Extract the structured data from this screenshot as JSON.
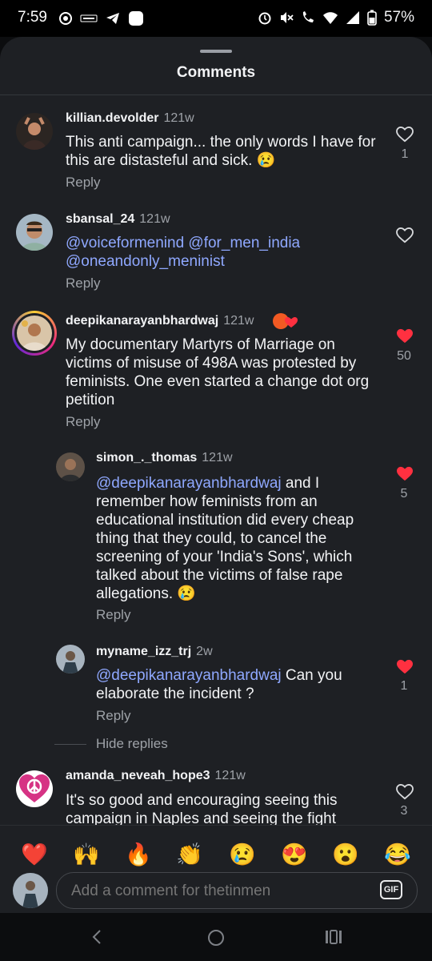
{
  "status_bar": {
    "time": "7:59",
    "battery": "57%"
  },
  "sheet": {
    "title": "Comments"
  },
  "comments": [
    {
      "username": "killian.devolder",
      "time": "121w",
      "text": "This anti campaign... the only words I have for this are distasteful and sick. 😢",
      "reply_label": "Reply",
      "likes": "1",
      "liked": false
    },
    {
      "username": "sbansal_24",
      "time": "121w",
      "mentions": [
        "@voiceformenind",
        "@for_men_india",
        "@oneandonly_meninist"
      ],
      "reply_label": "Reply",
      "likes": "",
      "liked": false
    },
    {
      "username": "deepikanarayanbhardwaj",
      "time": "121w",
      "text": "My documentary Martyrs of Marriage on victims of misuse of 498A was protested by feminists. One even started a change dot org petition",
      "reply_label": "Reply",
      "likes": "50",
      "liked": true
    },
    {
      "username": "simon_._thomas",
      "time": "121w",
      "mention": "@deepikanarayanbhardwaj",
      "text": " and I remember how feminists from an educational institution  did every cheap thing that they could, to cancel the screening of your 'India's Sons', which talked about the victims of false rape allegations. 😢",
      "reply_label": "Reply",
      "likes": "5",
      "liked": true
    },
    {
      "username": "myname_izz_trj",
      "time": "2w",
      "mention": "@deepikanarayanbhardwaj",
      "text": "  Can you elaborate the incident ?",
      "reply_label": "Reply",
      "likes": "1",
      "liked": true
    },
    {
      "username": "amanda_neveah_hope3",
      "time": "121w",
      "text": "It's so good and encouraging seeing this campaign in Naples and seeing the fight",
      "likes": "3",
      "liked": false
    }
  ],
  "hide_replies": "Hide replies",
  "reactions": [
    "❤️",
    "🙌",
    "🔥",
    "👏",
    "😢",
    "😍",
    "😮",
    "😂"
  ],
  "composer": {
    "placeholder": "Add a comment for thetinmen",
    "gif_label": "GIF"
  },
  "colors": {
    "background": "#1e2024",
    "mention": "#8fa8ff",
    "liked_heart": "#ff3040",
    "muted_text": "#9ea2a8"
  }
}
